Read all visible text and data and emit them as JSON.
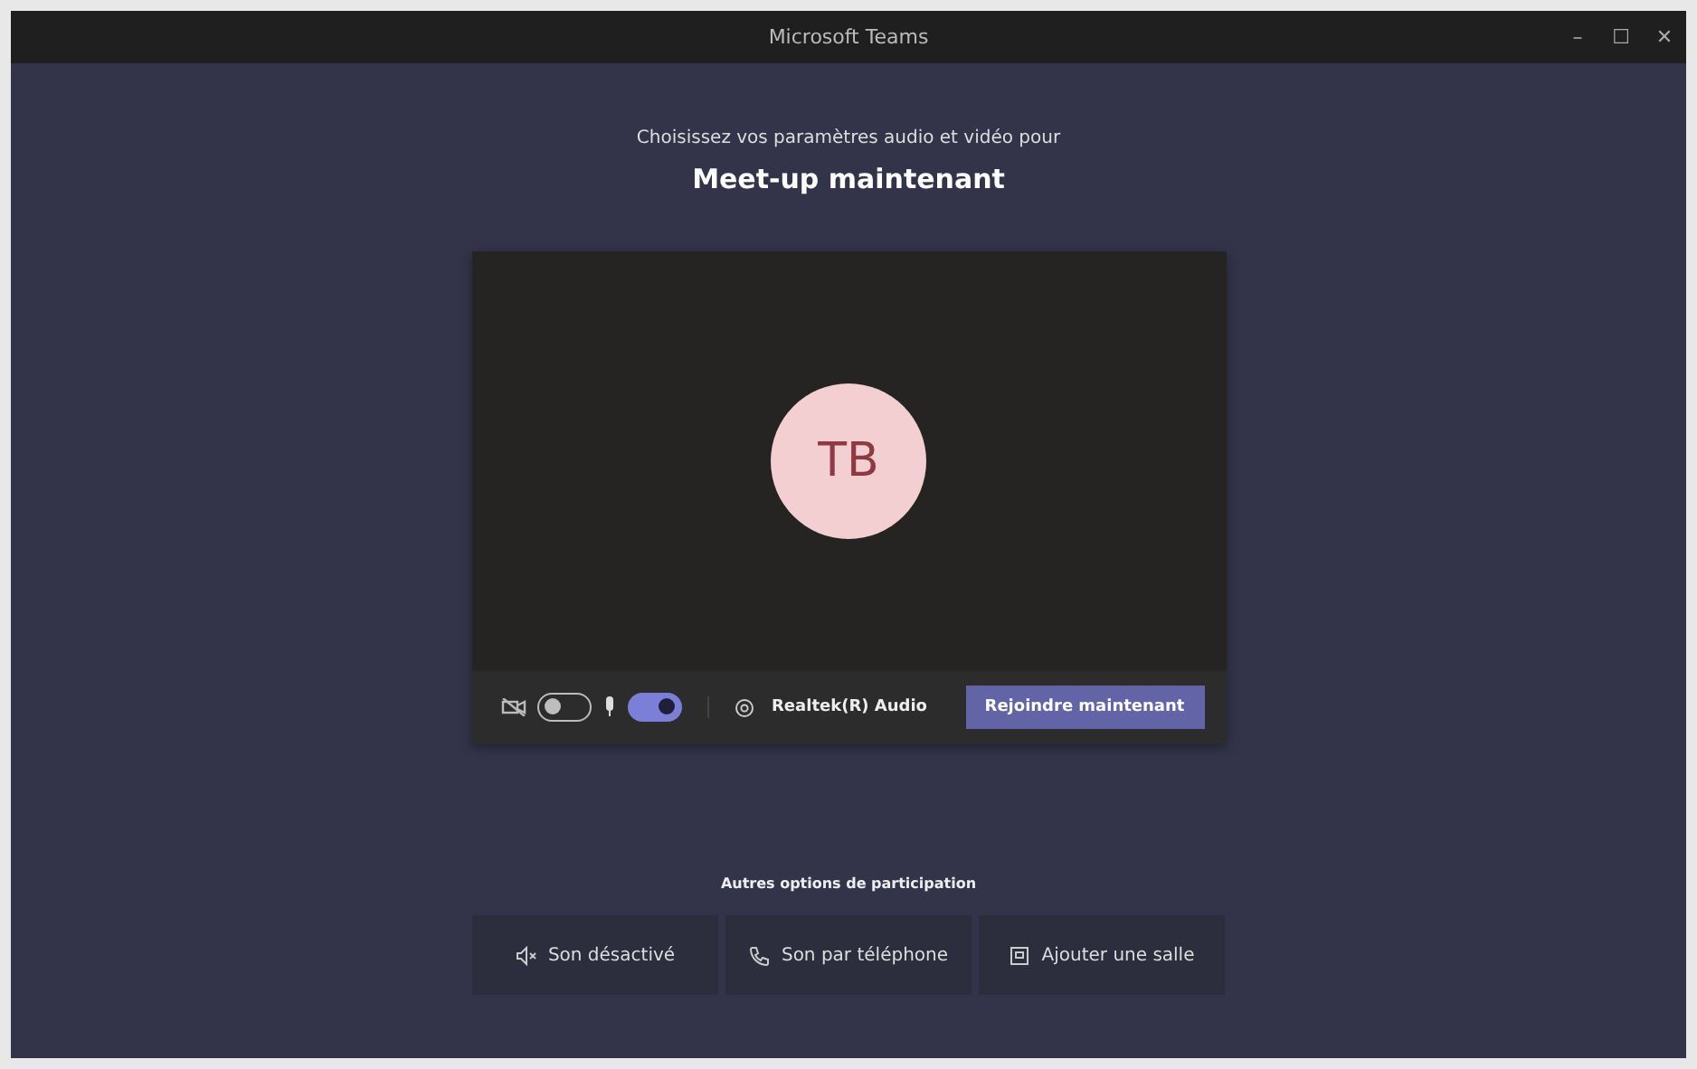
{
  "window": {
    "title": "Microsoft Teams",
    "controls": [
      "–",
      "☐",
      "✕"
    ]
  },
  "prompt": "Choisissez vos paramètres audio et vidéo pour",
  "meeting_title": "Meet-up maintenant",
  "avatar": {
    "initials": "TB"
  },
  "controls": {
    "camera": {
      "on": false
    },
    "microphone": {
      "on": true
    },
    "device": "Realtek(R) Audio",
    "join_button": "Rejoindre maintenant"
  },
  "other_options": {
    "heading": "Autres options de participation",
    "buttons": [
      {
        "kind": "audio-off",
        "label": "Son désactivé"
      },
      {
        "kind": "phone",
        "label": "Son par téléphone"
      },
      {
        "kind": "room",
        "label": "Ajouter une salle"
      }
    ]
  }
}
